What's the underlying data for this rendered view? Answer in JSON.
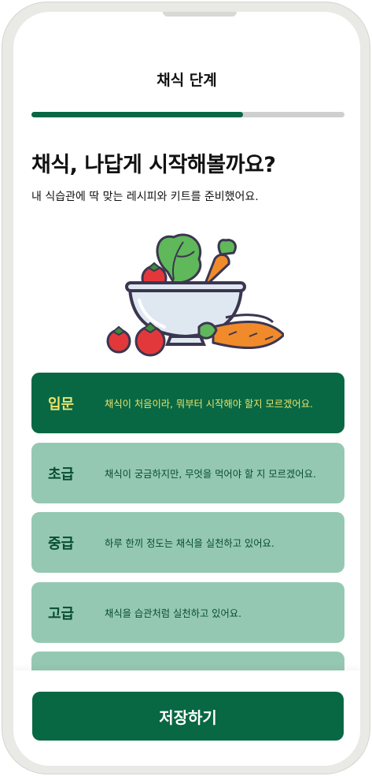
{
  "header": {
    "title": "채식 단계"
  },
  "progress": {
    "fraction": 0.676
  },
  "intro": {
    "headline": "채식, 나답게 시작해볼까요?",
    "subline": "내 식습관에 딱 맞는 레시피와 키트를 준비했어요."
  },
  "illustration": {
    "icon": "vegetable-bowl"
  },
  "options": [
    {
      "level": "입문",
      "desc": "채식이 처음이라, 뭐부터 시작해야 할지 모르겠어요.",
      "selected": true
    },
    {
      "level": "초급",
      "desc": "채식이 궁금하지만, 무엇을 먹어야 할 지 모르겠어요.",
      "selected": false
    },
    {
      "level": "중급",
      "desc": "하루 한끼 정도는 채식을 실천하고 있어요.",
      "selected": false
    },
    {
      "level": "고급",
      "desc": "채식을 습관처럼 실천하고 있어요.",
      "selected": false
    }
  ],
  "footer": {
    "save_label": "저장하기"
  },
  "colors": {
    "primary": "#076843",
    "option_bg": "#95c8b2",
    "selected_text": "#ebe36e"
  }
}
